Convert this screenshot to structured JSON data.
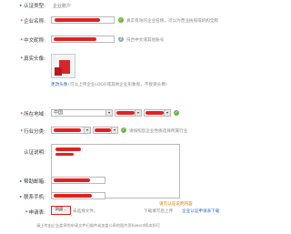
{
  "form": {
    "cert_type": {
      "label": "认证类型:",
      "value": "企业账户"
    },
    "company_name": {
      "label": "企业名称:",
      "hint": "真实有效的企业名称，可以为营业执照或机构全称"
    },
    "chinese_nick": {
      "label": "中文昵称:",
      "hint": "符合中文或其他账号"
    },
    "avatar": {
      "label": "真实头像:",
      "hint_link": "更改头像",
      "hint": "(可以上传企业LOGO或其他企业形象照，不接受头像)"
    },
    "location": {
      "label": "所在地域:",
      "country": "中国"
    },
    "industry": {
      "label": "行业分类:",
      "hint": "请按照您企业性质选择所属行业"
    },
    "description": {
      "label": "认证说明:",
      "footer": "请写认证说明内容"
    },
    "helper": {
      "label": "帮助邮箱:"
    },
    "contact_phone": {
      "label": "联系手机:"
    },
    "apply_form": {
      "label": "申请表:",
      "browse_button": "浏览...",
      "file_placeholder": "未选择文件。",
      "note": "下载填写后上传",
      "download_link": "企业认证申请表下载"
    },
    "footnote": "请上传由企业盖章的申请文件扫描件或加盖公章的图片资料word版本即可"
  },
  "colors": {
    "red_mark": "#e4201e",
    "ok_green": "#6cb33e",
    "link_blue": "#2a6bc9"
  }
}
